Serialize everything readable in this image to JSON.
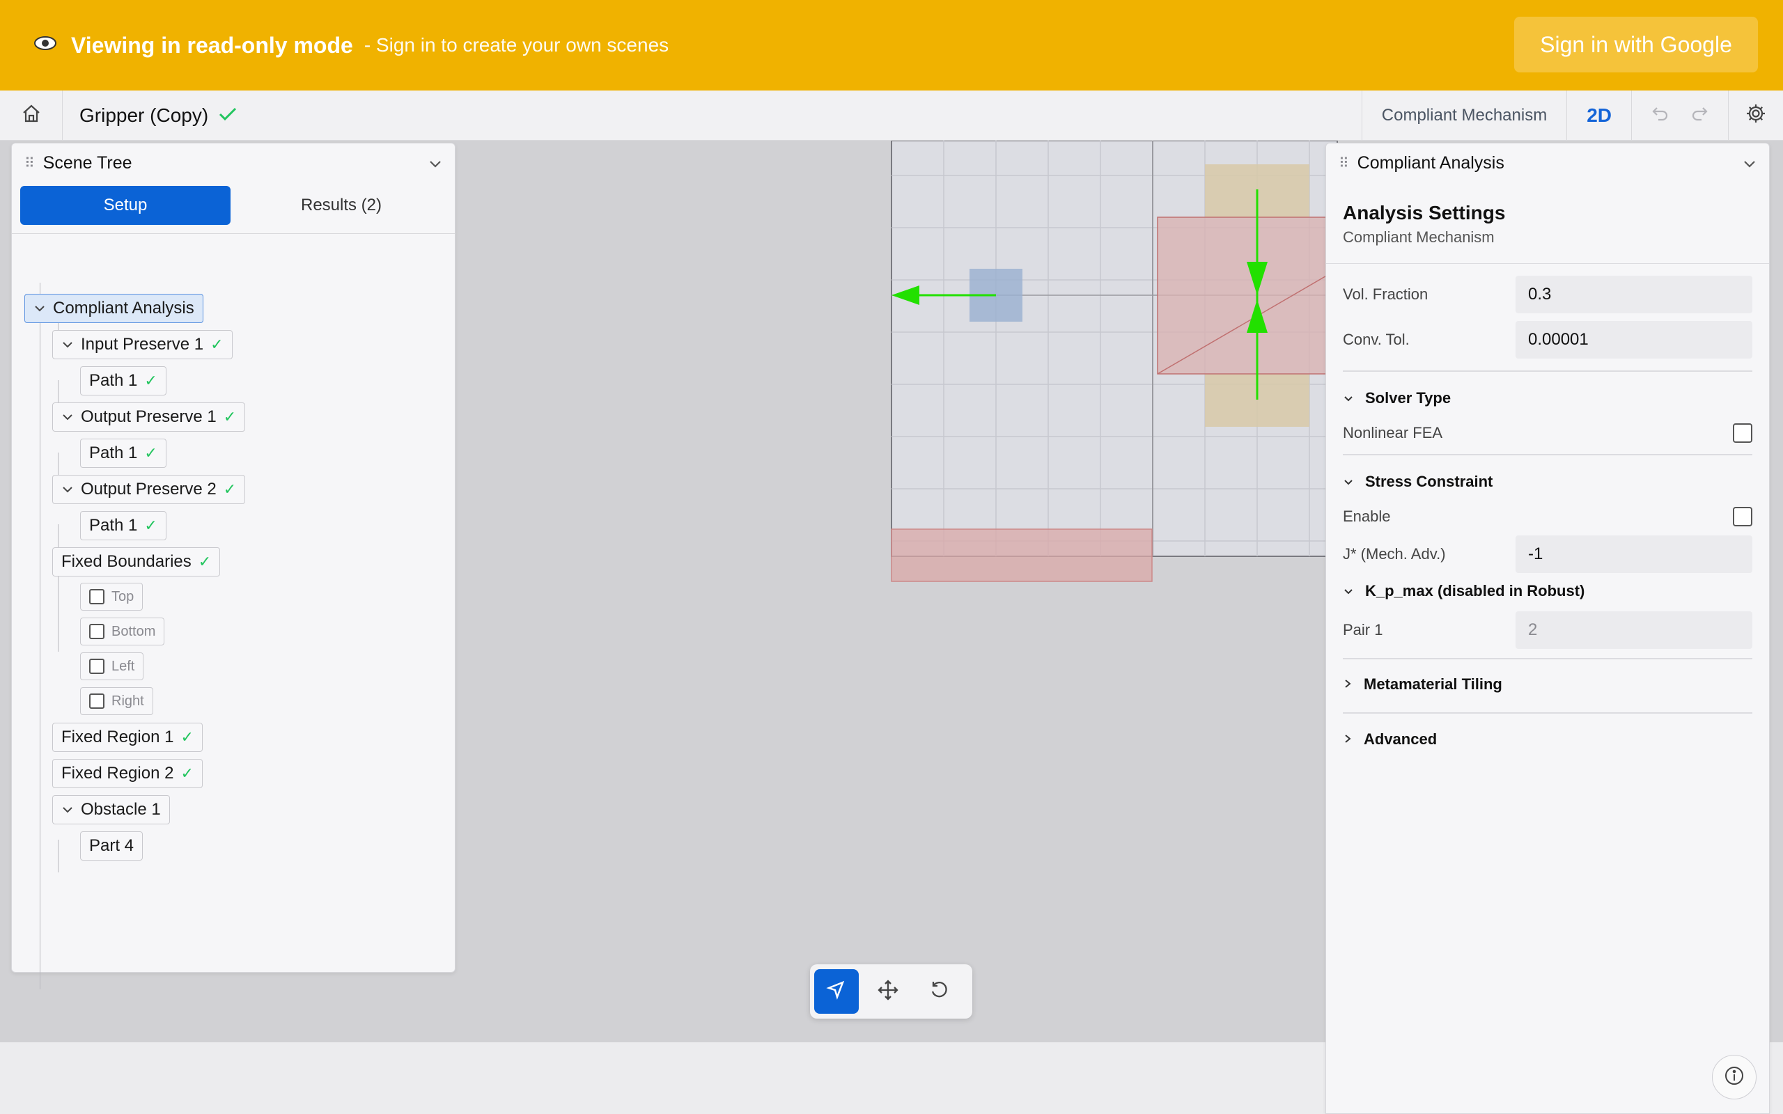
{
  "banner": {
    "title": "Viewing in read-only mode",
    "subtitle": "- Sign in to create your own scenes",
    "signin_label": "Sign in with Google",
    "eye_icon": "eye-icon"
  },
  "toolbar": {
    "doc_title": "Gripper (Copy)",
    "mode_label": "Compliant Mechanism",
    "view_label": "2D"
  },
  "scene_tree": {
    "header": "Scene Tree",
    "tabs": [
      {
        "label": "Setup"
      },
      {
        "label": "Results (2)"
      }
    ],
    "nodes": {
      "root": "Compliant Analysis",
      "input1": "Input Preserve 1",
      "input1_path": "Path 1",
      "output1": "Output Preserve 1",
      "output1_path": "Path 1",
      "output2": "Output Preserve 2",
      "output2_path": "Path 1",
      "fixed_boundaries": "Fixed Boundaries",
      "fb_top": "Top",
      "fb_bottom": "Bottom",
      "fb_left": "Left",
      "fb_right": "Right",
      "fixed_region1": "Fixed Region 1",
      "fixed_region2": "Fixed Region 2",
      "obstacle1": "Obstacle 1",
      "part4": "Part 4"
    }
  },
  "analysis_panel": {
    "header": "Compliant Analysis",
    "title": "Analysis Settings",
    "subtitle": "Compliant Mechanism",
    "vol_fraction_label": "Vol. Fraction",
    "vol_fraction_value": "0.3",
    "conv_tol_label": "Conv. Tol.",
    "conv_tol_value": "0.00001",
    "solver_type_label": "Solver Type",
    "nonlinear_label": "Nonlinear FEA",
    "stress_label": "Stress Constraint",
    "enable_label": "Enable",
    "jstar_label": "J* (Mech. Adv.)",
    "jstar_value": "-1",
    "kpmax_label": "K_p_max (disabled in Robust)",
    "pair1_label": "Pair 1",
    "pair1_value": "2",
    "metamaterial_label": "Metamaterial Tiling",
    "advanced_label": "Advanced"
  },
  "colors": {
    "banner": "#f0b200",
    "accent": "#0b63d6",
    "check": "#22c55e",
    "arrow": "#22e000"
  }
}
